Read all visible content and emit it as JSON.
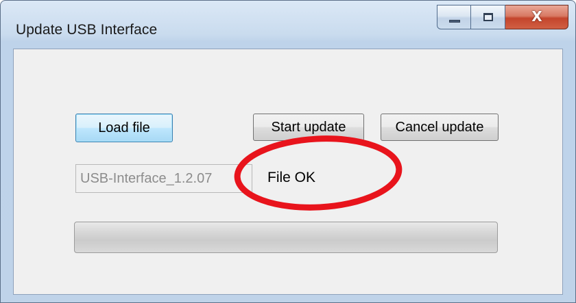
{
  "window": {
    "title": "Update USB Interface",
    "close_glyph": "X"
  },
  "buttons": {
    "load_label": "Load file",
    "start_label": "Start update",
    "cancel_label": "Cancel update"
  },
  "file": {
    "value": "USB-Interface_1.2.07",
    "status": "File OK"
  },
  "progress": {
    "fraction": 0
  },
  "colors": {
    "annotation_ring": "#e8141c"
  },
  "icons": [
    "minimize-icon",
    "maximize-icon",
    "close-icon"
  ]
}
